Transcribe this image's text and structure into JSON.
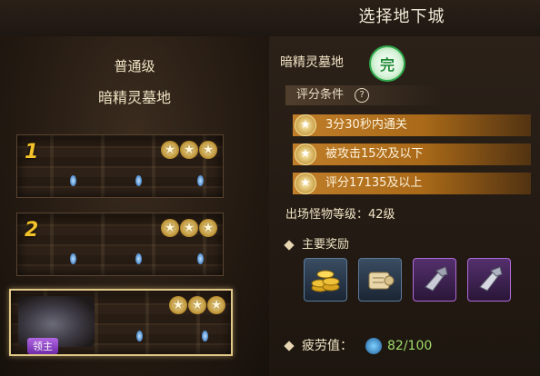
{
  "header": {
    "title": "选择地下城"
  },
  "left": {
    "difficulty": "普通级",
    "dungeon_name": "暗精灵墓地",
    "stages": [
      {
        "number": "1",
        "stars": 3
      },
      {
        "number": "2",
        "stars": 3
      },
      {
        "number": "",
        "stars": 3,
        "badge": "领主"
      }
    ]
  },
  "right": {
    "dungeon_name": "暗精灵墓地",
    "grade_icon_text": "完",
    "criteria_title": "评分条件",
    "help_symbol": "?",
    "criteria": [
      "3分30秒内通关",
      "被攻击15次及以下",
      "评分17135及以上"
    ],
    "monster_level": "出场怪物等级：42级",
    "rewards_title": "主要奖励",
    "rewards": [
      {
        "icon": "gold-coins-icon"
      },
      {
        "icon": "scroll-icon"
      },
      {
        "icon": "gauntlet-icon"
      },
      {
        "icon": "gauntlet-icon"
      }
    ],
    "fatigue_label": "疲劳值：",
    "fatigue_value": "82/100"
  },
  "colors": {
    "criteria_bar": "#c07e2a",
    "star_gold": "#caa046",
    "boss_badge": "#8d3fc6",
    "fatigue_value": "#9fdc6a",
    "grade_icon": "#2fa84a"
  }
}
